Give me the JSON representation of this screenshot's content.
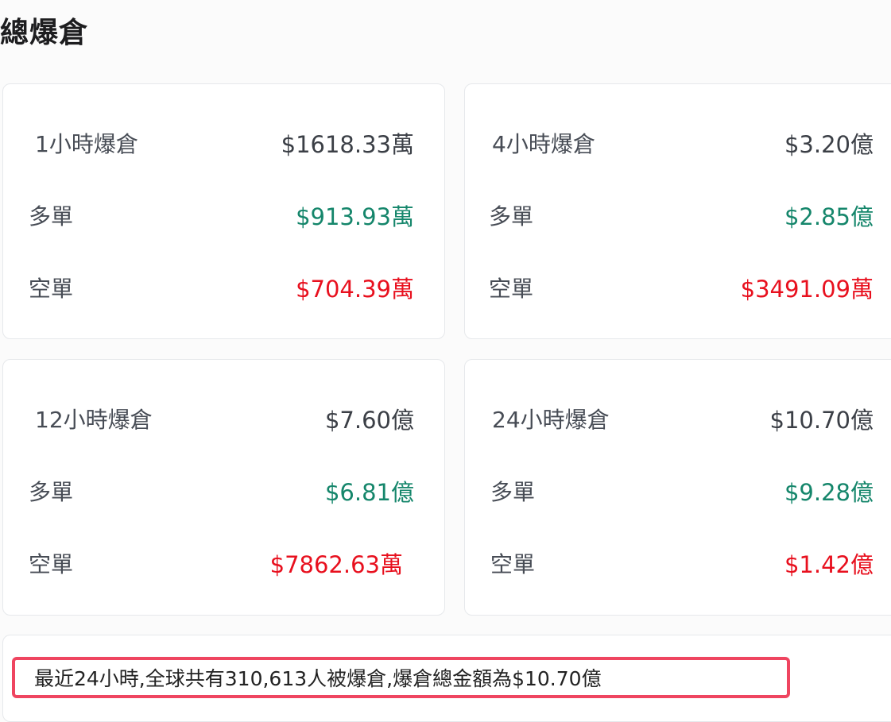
{
  "page": {
    "title": "總爆倉"
  },
  "cards": [
    {
      "period": "1小時爆倉",
      "total": "$1618.33萬",
      "long_label": "多單",
      "long_value": "$913.93萬",
      "short_label": "空單",
      "short_value": "$704.39萬"
    },
    {
      "period": "4小時爆倉",
      "total": "$3.20億",
      "long_label": "多單",
      "long_value": "$2.85億",
      "short_label": "空單",
      "short_value": "$3491.09萬"
    },
    {
      "period": "12小時爆倉",
      "total": "$7.60億",
      "long_label": "多單",
      "long_value": "$6.81億",
      "short_label": "空單",
      "short_value": "$7862.63萬"
    },
    {
      "period": "24小時爆倉",
      "total": "$10.70億",
      "long_label": "多單",
      "long_value": "$9.28億",
      "short_label": "空單",
      "short_value": "$1.42億"
    }
  ],
  "summary": {
    "text": "最近24小時,全球共有310,613人被爆倉,爆倉總金額為$10.70億"
  },
  "colors": {
    "long": "#15866b",
    "short": "#e8101e",
    "highlight_border": "#ef4560"
  }
}
